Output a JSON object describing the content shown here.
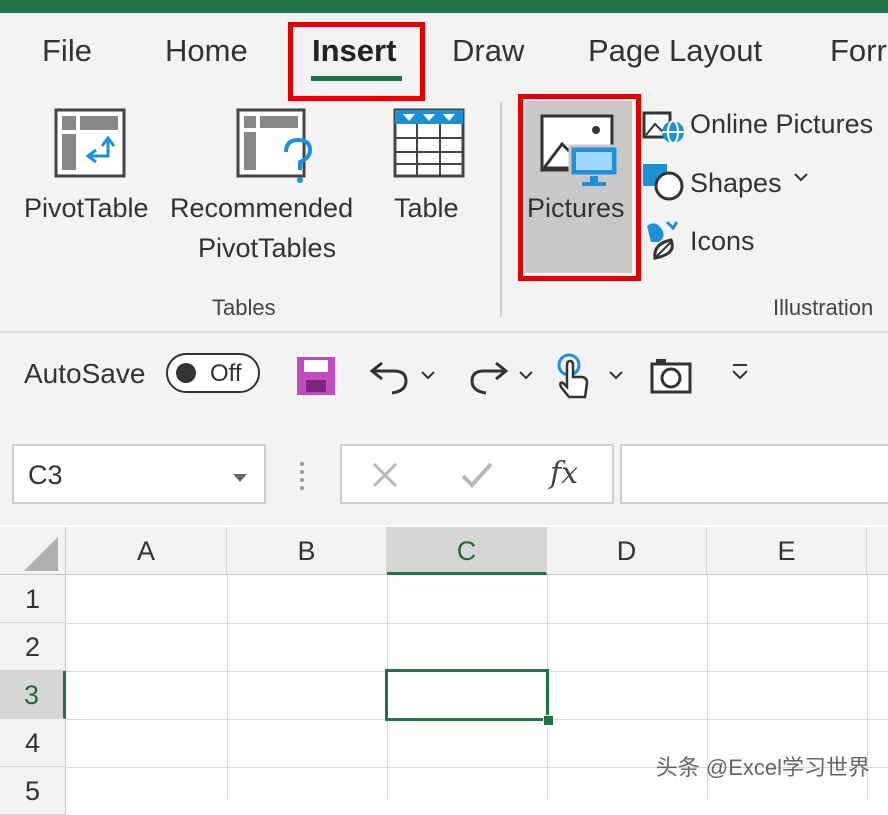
{
  "ribbon": {
    "tabs": [
      "File",
      "Home",
      "Insert",
      "Draw",
      "Page Layout",
      "Forr"
    ],
    "active_tab": "Insert",
    "tables_group": {
      "label": "Tables",
      "pivottable": "PivotTable",
      "recommended_line1": "Recommended",
      "recommended_line2": "PivotTables",
      "table": "Table"
    },
    "illustrations_group": {
      "label": "Illustration",
      "pictures": "Pictures",
      "online_pictures": "Online Pictures",
      "shapes": "Shapes",
      "icons": "Icons"
    }
  },
  "qat": {
    "autosave_label": "AutoSave",
    "toggle_state": "Off"
  },
  "formula_bar": {
    "name_box": "C3",
    "fx": "fx",
    "formula_value": ""
  },
  "sheet": {
    "columns": [
      "A",
      "B",
      "C",
      "D",
      "E"
    ],
    "rows": [
      "1",
      "2",
      "3",
      "4",
      "5"
    ],
    "active_cell": "C3"
  },
  "watermark": "头条 @Excel学习世界",
  "colors": {
    "accent_green": "#217346",
    "highlight_red": "#e00000",
    "save_purple": "#c04cc0",
    "icon_blue": "#1e90d8"
  }
}
